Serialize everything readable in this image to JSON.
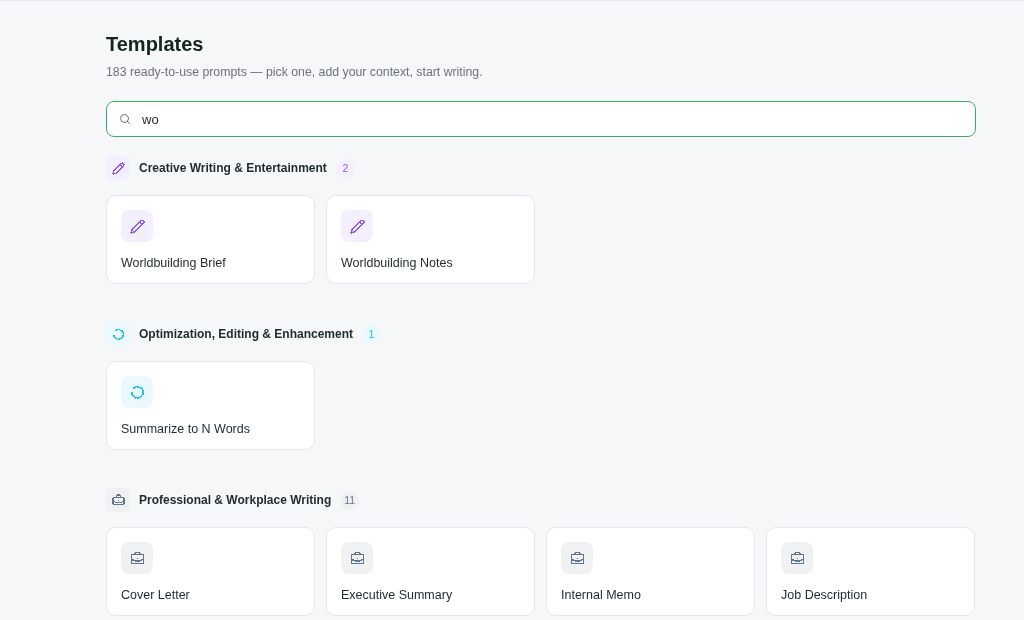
{
  "page": {
    "title": "Templates",
    "subtitle": "183 ready-to-use prompts — pick one, add your context, start writing."
  },
  "search": {
    "value": "wo"
  },
  "sections": [
    {
      "title": "Creative Writing & Entertainment",
      "count": "2",
      "kind": "creative",
      "color": "#8b5cf6",
      "templates": [
        {
          "title": "Worldbuilding Brief"
        },
        {
          "title": "Worldbuilding Notes"
        }
      ]
    },
    {
      "title": "Optimization, Editing & Enhancement",
      "count": "1",
      "kind": "editing",
      "color": "#22c3e6",
      "templates": [
        {
          "title": "Summarize to N Words"
        }
      ]
    },
    {
      "title": "Professional & Workplace Writing",
      "count": "11",
      "kind": "workplace",
      "color": "#64748b",
      "templates": [
        {
          "title": "Cover Letter"
        },
        {
          "title": "Executive Summary"
        },
        {
          "title": "Internal Memo"
        },
        {
          "title": "Job Description"
        }
      ]
    }
  ]
}
